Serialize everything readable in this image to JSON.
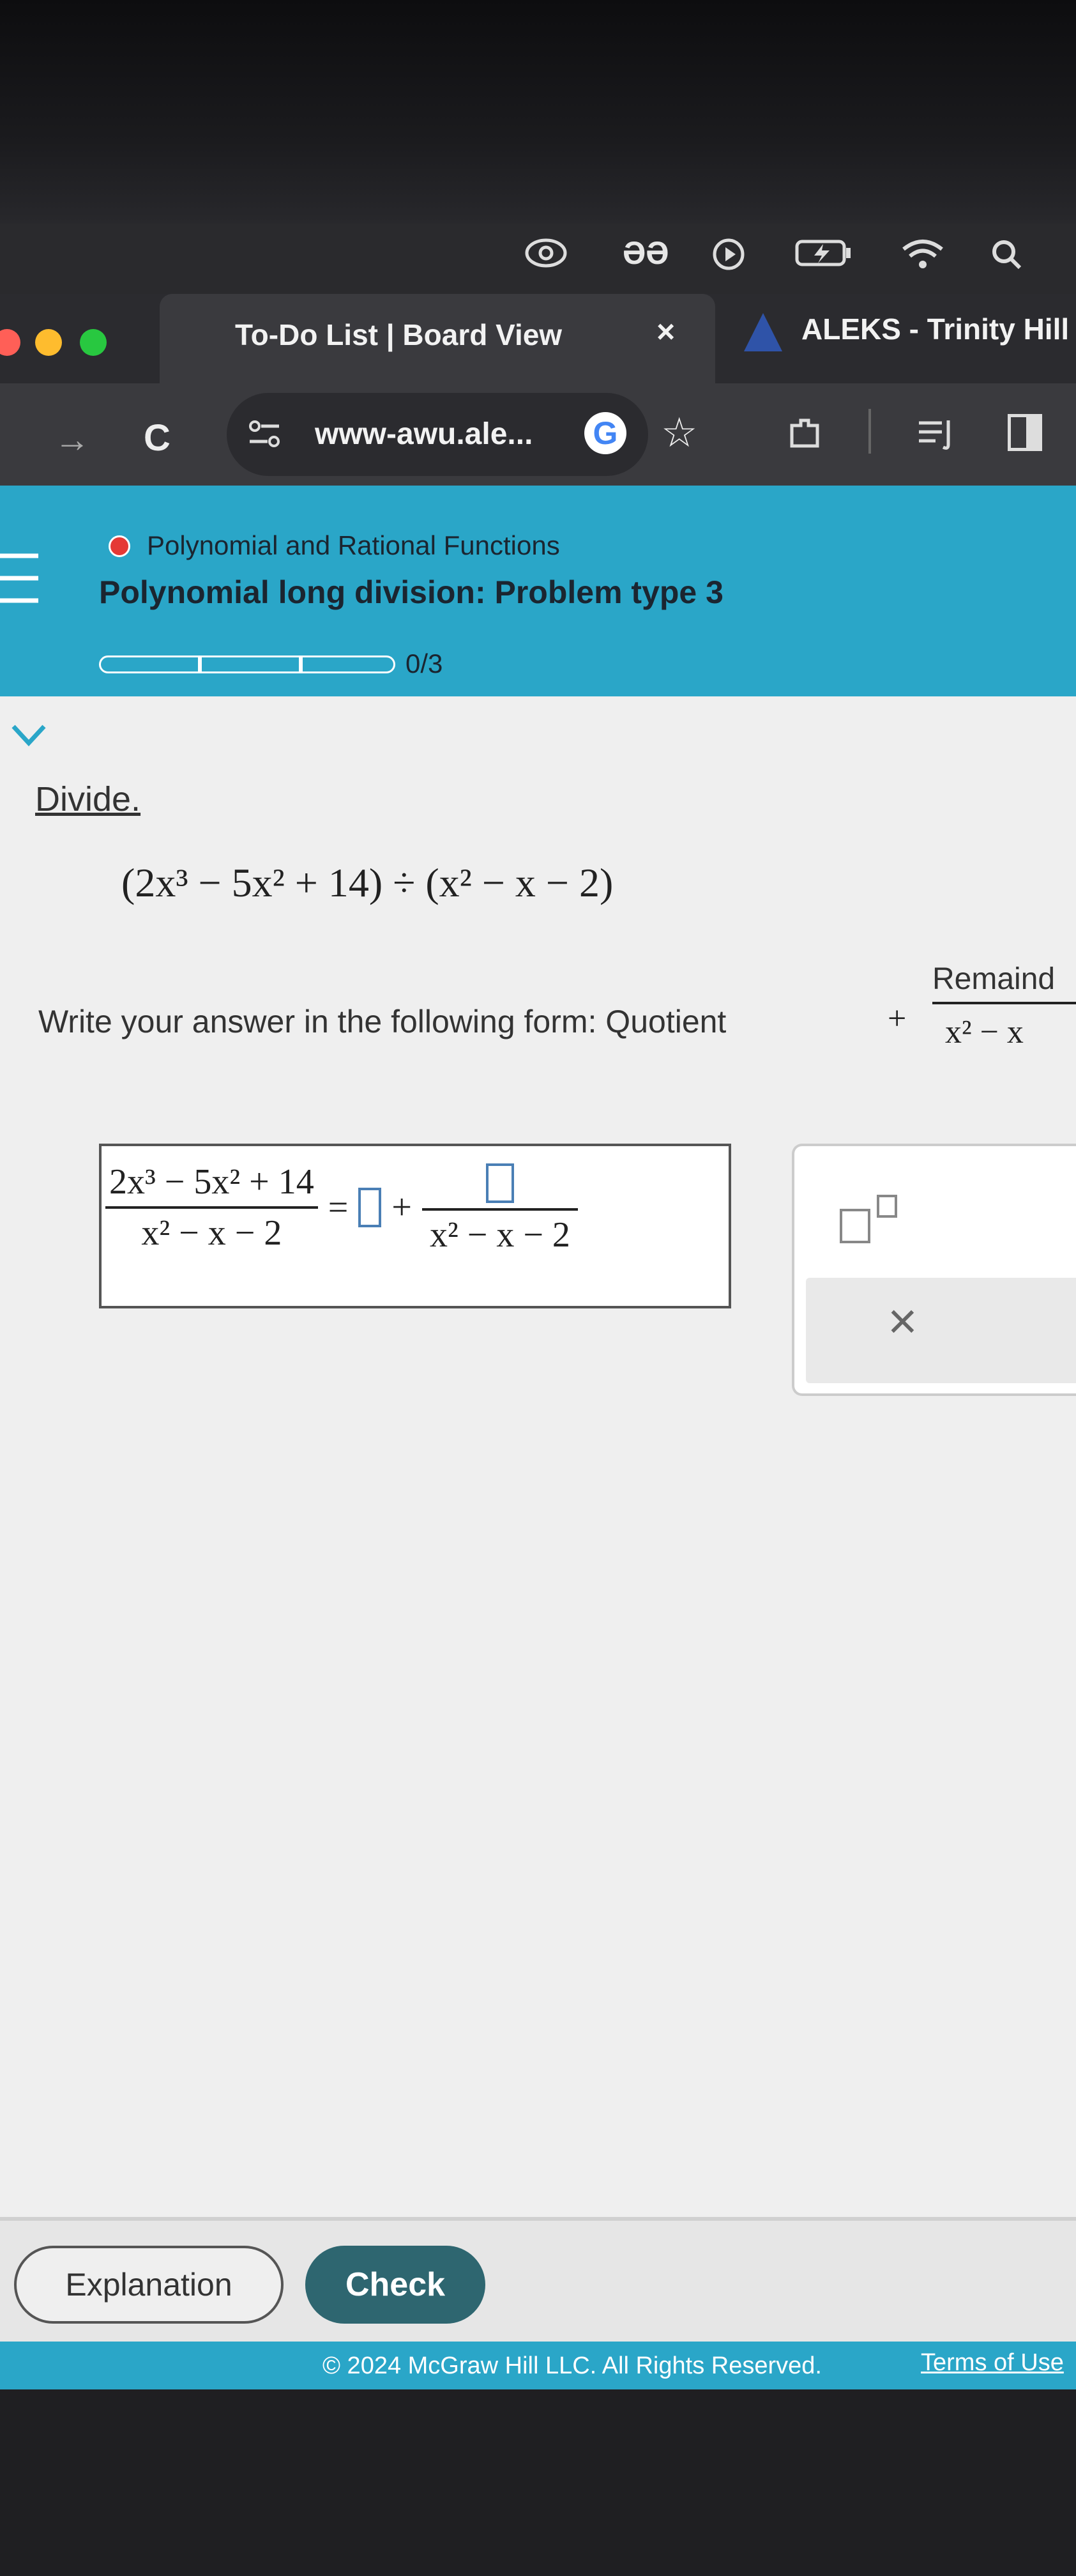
{
  "menubar": {
    "icons": [
      "creative-cloud-icon",
      "ai-icon",
      "play-icon",
      "battery-icon",
      "wifi-icon",
      "search-icon"
    ],
    "ai_text": "ƏƏ"
  },
  "tabs": [
    {
      "label": "To-Do List | Board View",
      "close": "×"
    },
    {
      "label": "ALEKS - Trinity Hill -"
    }
  ],
  "nav": {
    "back": "→",
    "reload": "C",
    "url": "www-awu.ale...",
    "google": "G",
    "star": "☆"
  },
  "header": {
    "topic": "Polynomial and Rational Functions",
    "title": "Polynomial long division: Problem type 3",
    "progress": "0/3",
    "progress_value": 0,
    "progress_total": 3
  },
  "problem": {
    "instruction": "Divide.",
    "expr_left": "(2x³ − 5x² + 14)",
    "divide_sign": "÷",
    "expr_right": "(x² − x − 2)",
    "form_prompt": "Write your answer in the following form: Quotient",
    "plus": "+",
    "form_num": "Remaind",
    "form_den": "x² − x"
  },
  "answer": {
    "lhs_num": "2x³ − 5x² + 14",
    "lhs_den": "x² − x − 2",
    "equals": "=",
    "plus": "+",
    "rhs_den": "x² − x − 2"
  },
  "keypad": {
    "exponent": "□",
    "clear": "×"
  },
  "footer": {
    "explanation_label": "Explanation",
    "check_label": "Check",
    "copyright": "© 2024 McGraw Hill LLC. All Rights Reserved.",
    "terms": "Terms of Use"
  },
  "colors": {
    "header_teal": "#2aa6c8",
    "check_button": "#2e6670",
    "topic_dot": "#e53935"
  }
}
